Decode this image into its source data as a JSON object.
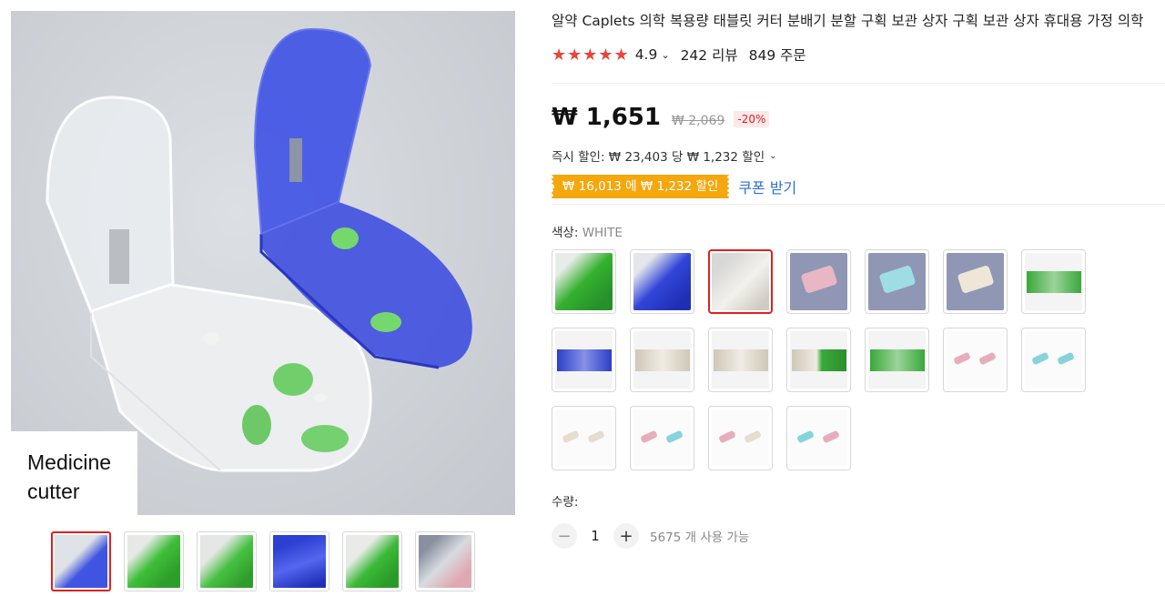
{
  "gallery": {
    "caption": "Medicine\ncutter",
    "thumbs": [
      "blue-white",
      "green",
      "green",
      "blue",
      "green",
      "pink"
    ]
  },
  "product": {
    "title": "알약 Caplets 의학 복용량 태블릿 커터 분배기 분할 구획 보관 상자 구획 보관 상자 휴대용 가정 의학",
    "rating": "4.9",
    "stars": "★★★★★",
    "reviews": "242 리뷰",
    "orders": "849 주문"
  },
  "price": {
    "current": "₩ 1,651",
    "original": "₩ 2,069",
    "discount": "-20%"
  },
  "promo": {
    "instant": "즉시 할인: ₩ 23,403 당 ₩ 1,232 할인",
    "coupon": "₩ 16,013 에 ₩ 1,232 할인",
    "coupon_link": "쿠폰 받기"
  },
  "color": {
    "label": "색상: ",
    "selected": "WHITE",
    "swatches": [
      "green",
      "blue",
      "white",
      "pink",
      "cyan",
      "beige",
      "green-pair",
      "blue-pair",
      "white-pair",
      "white-pair",
      "green-white-pair",
      "green-pair",
      "pink-pair",
      "cyan-pair",
      "white-pair",
      "pink-cyan-pair",
      "pink-white-pair",
      "cyan-pink-pair"
    ]
  },
  "quantity": {
    "label": "수량:",
    "value": "1",
    "minus": "−",
    "plus": "+",
    "available": "5675 개 사용 가능"
  },
  "colors": {
    "accent": "#e02020",
    "star": "#e8473a",
    "coupon": "#f5a70e",
    "link": "#2b6fd6"
  },
  "icons": {
    "rating_chevron": "chevron-down-icon",
    "instant_chevron": "chevron-down-icon"
  }
}
